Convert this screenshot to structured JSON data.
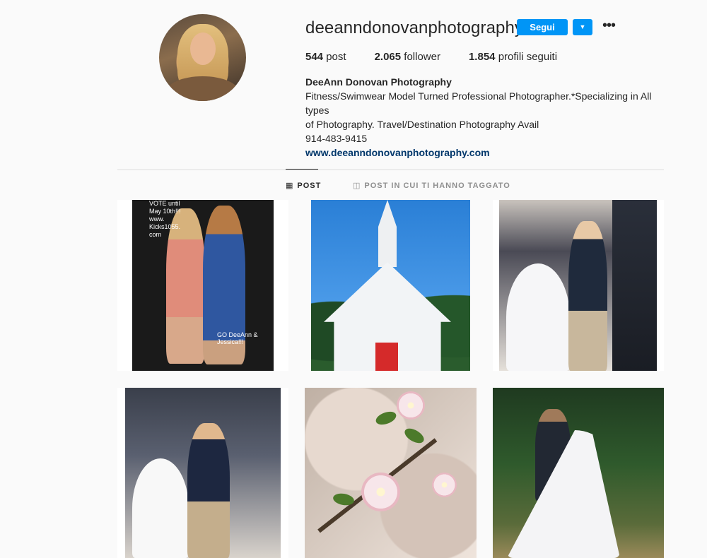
{
  "profile": {
    "username": "deeanndonovanphotography",
    "follow_label": "Segui",
    "dropdown_icon": "chevron-down-icon",
    "more_icon": "more-options-icon"
  },
  "stats": {
    "posts_count": "544",
    "posts_label": "post",
    "followers_count": "2.065",
    "followers_label": "follower",
    "following_count": "1.854",
    "following_label": "profili seguiti"
  },
  "bio": {
    "name": "DeeAnn Donovan Photography",
    "line1": "Fitness/Swimwear Model Turned Professional Photographer.*Specializing in All types",
    "line2": "of Photography. Travel/Destination Photography Avail",
    "phone": "914-483-9415",
    "website": "www.deeanndonovanphotography.com"
  },
  "tabs": [
    {
      "label": "POST",
      "icon": "grid-icon",
      "active": true
    },
    {
      "label": "POST IN CUI TI HANNO TAGGATO",
      "icon": "tagged-icon",
      "active": false
    }
  ],
  "posts": [
    {
      "overlay_top": "VOTE until May 10th!!! www. Kicks1055. com",
      "overlay_bottom": "GO DeeAnn & Jessica!!!"
    },
    {},
    {},
    {},
    {},
    {}
  ],
  "colors": {
    "accent": "#0095f6",
    "link": "#00376b",
    "background": "#fafafa"
  }
}
